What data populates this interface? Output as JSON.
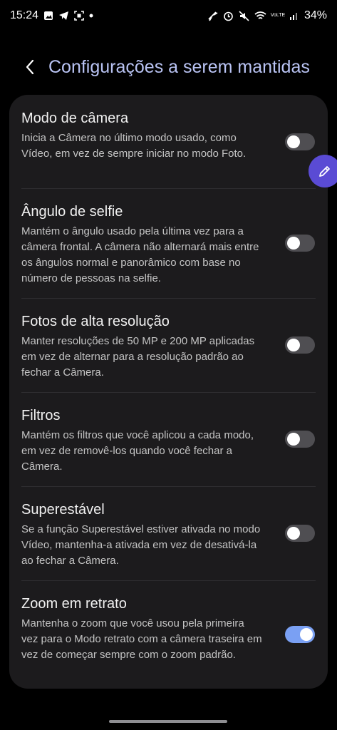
{
  "status_bar": {
    "time": "15:24",
    "battery": "34%",
    "volte": "VoLTE"
  },
  "header": {
    "title": "Configurações a serem mantidas"
  },
  "settings": [
    {
      "title": "Modo de câmera",
      "description": "Inicia a Câmera no último modo usado, como Vídeo, em vez de sempre iniciar no modo Foto.",
      "enabled": false
    },
    {
      "title": "Ângulo de selfie",
      "description": "Mantém o ângulo usado pela última vez para a câmera frontal. A câmera não alternará mais entre os ângulos normal e panorâmico com base no número de pessoas na selfie.",
      "enabled": false
    },
    {
      "title": "Fotos de alta resolução",
      "description": "Manter resoluções de 50 MP e 200 MP aplicadas em vez de alternar para a resolução padrão ao fechar a Câmera.",
      "enabled": false
    },
    {
      "title": "Filtros",
      "description": "Mantém os filtros que você aplicou a cada modo, em vez de removê-los quando você fechar a Câmera.",
      "enabled": false
    },
    {
      "title": "Superestável",
      "description": "Se a função Superestável estiver ativada no modo Vídeo, mantenha-a ativada em vez de desativá-la ao fechar a Câmera.",
      "enabled": false
    },
    {
      "title": "Zoom em retrato",
      "description": "Mantenha o zoom que você usou pela primeira vez para o Modo retrato com a câmera traseira em vez de começar sempre com o zoom padrão.",
      "enabled": true
    }
  ],
  "colors": {
    "title": "#b9c3f3",
    "toggle_on": "#7aa0f3",
    "toggle_off": "#4f4e52",
    "card": "#1c1b1d",
    "float_button": "#5a4bd4"
  },
  "icons": [
    "gallery-icon",
    "telegram-icon",
    "screenshot-icon",
    "dot-icon",
    "airplane-off-icon",
    "alarm-icon",
    "mute-icon",
    "wifi-icon",
    "signal-icon",
    "back-icon",
    "pencil-icon"
  ]
}
